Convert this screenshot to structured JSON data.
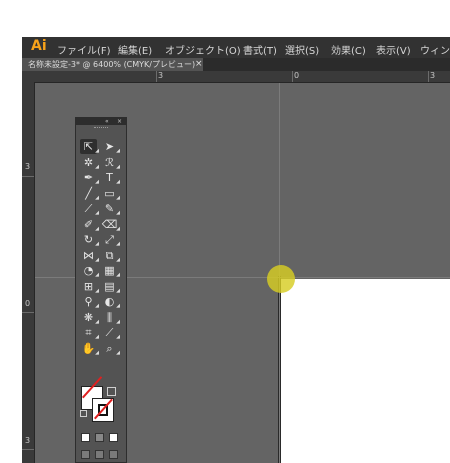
{
  "app": {
    "logo": "Ai"
  },
  "menus": [
    "ファイル(F)",
    "編集(E)",
    "オブジェクト(O)",
    "書式(T)",
    "選択(S)",
    "効果(C)",
    "表示(V)",
    "ウィンドウ"
  ],
  "document_tab": {
    "title": "名称未設定-3* @ 6400% (CMYK/プレビュー)",
    "close": "×"
  },
  "ruler": {
    "top_labels": [
      "3",
      "0",
      "3"
    ],
    "left_labels": [
      "3",
      "0",
      "3"
    ]
  },
  "toolbox": {
    "collapse": "«",
    "close": "×",
    "tools": [
      {
        "name": "selection-tool",
        "glyph": "⇱",
        "active": true
      },
      {
        "name": "direct-selection-tool",
        "glyph": "➤",
        "active": false
      },
      {
        "name": "magic-wand-tool",
        "glyph": "✲",
        "active": false
      },
      {
        "name": "lasso-tool",
        "glyph": "ℛ",
        "active": false
      },
      {
        "name": "pen-tool",
        "glyph": "✒",
        "active": false
      },
      {
        "name": "type-tool",
        "glyph": "T",
        "active": false
      },
      {
        "name": "line-segment-tool",
        "glyph": "╱",
        "active": false
      },
      {
        "name": "rectangle-tool",
        "glyph": "▭",
        "active": false
      },
      {
        "name": "paintbrush-tool",
        "glyph": "⟋",
        "active": false
      },
      {
        "name": "pencil-tool",
        "glyph": "✎",
        "active": false
      },
      {
        "name": "blob-brush-tool",
        "glyph": "✐",
        "active": false
      },
      {
        "name": "eraser-tool",
        "glyph": "⌫",
        "active": false
      },
      {
        "name": "rotate-tool",
        "glyph": "↻",
        "active": false
      },
      {
        "name": "scale-tool",
        "glyph": "⤢",
        "active": false
      },
      {
        "name": "width-tool",
        "glyph": "⋈",
        "active": false
      },
      {
        "name": "free-transform-tool",
        "glyph": "⧉",
        "active": false
      },
      {
        "name": "shape-builder-tool",
        "glyph": "◔",
        "active": false
      },
      {
        "name": "perspective-grid-tool",
        "glyph": "▦",
        "active": false
      },
      {
        "name": "mesh-tool",
        "glyph": "⊞",
        "active": false
      },
      {
        "name": "gradient-tool",
        "glyph": "▤",
        "active": false
      },
      {
        "name": "eyedropper-tool",
        "glyph": "⚲",
        "active": false
      },
      {
        "name": "blend-tool",
        "glyph": "◐",
        "active": false
      },
      {
        "name": "symbol-sprayer-tool",
        "glyph": "❋",
        "active": false
      },
      {
        "name": "column-graph-tool",
        "glyph": "⫼",
        "active": false
      },
      {
        "name": "artboard-tool",
        "glyph": "⌗",
        "active": false
      },
      {
        "name": "slice-tool",
        "glyph": "⟋",
        "active": false
      },
      {
        "name": "hand-tool",
        "glyph": "✋",
        "active": false
      },
      {
        "name": "zoom-tool",
        "glyph": "⌕",
        "active": false
      }
    ]
  },
  "colors": {
    "accent_logo": "#f7a21a",
    "touch_indicator": "#d7cd23",
    "none_slash": "#e02020"
  }
}
